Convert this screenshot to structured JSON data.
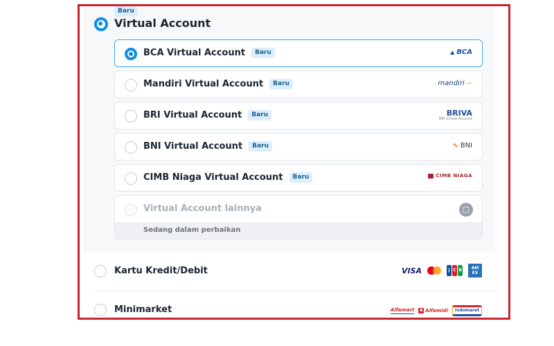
{
  "group": {
    "badge": "Baru",
    "title": "Virtual Account",
    "selected": true
  },
  "banks": [
    {
      "label": "BCA Virtual Account",
      "badge": "Baru",
      "logo_text": "BCA",
      "selected": true
    },
    {
      "label": "Mandiri Virtual Account",
      "badge": "Baru",
      "logo_text": "mandiri",
      "selected": false
    },
    {
      "label": "BRI Virtual Account",
      "badge": "Baru",
      "logo_text": "BRIVA",
      "logo_sub": "BRI Virtual Account",
      "selected": false
    },
    {
      "label": "BNI Virtual Account",
      "badge": "Baru",
      "logo_text": "BNI",
      "selected": false
    },
    {
      "label": "CIMB Niaga Virtual Account",
      "badge": "Baru",
      "logo_text": "CIMB NIAGA",
      "selected": false
    }
  ],
  "other_va": {
    "label": "Virtual Account lainnya",
    "maintenance_text": "Sedang dalam perbaikan",
    "icon": "bank-icon"
  },
  "sections": [
    {
      "title": "Kartu Kredit/Debit",
      "logos": [
        "VISA",
        "mastercard",
        "JCB",
        "AMEX"
      ]
    },
    {
      "title": "Minimarket",
      "logos": [
        "Alfamart",
        "Alfamidi",
        "Indomaret"
      ]
    }
  ],
  "colors": {
    "accent": "#0e8ee6",
    "badge_bg": "#dceefb",
    "frame_border": "#c8232c"
  }
}
